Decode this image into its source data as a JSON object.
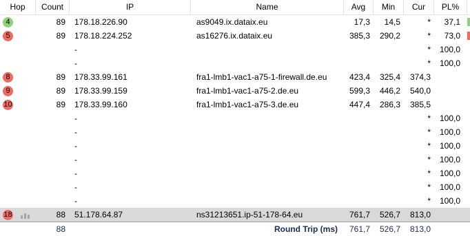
{
  "columns": [
    "Hop",
    "Count",
    "IP",
    "Name",
    "Avg",
    "Min",
    "Cur",
    "PL%"
  ],
  "colors": {
    "green": "#8fd17c",
    "red": "#f06a5f",
    "selected": "#d9d9d9",
    "accent": "#1f2a5a"
  },
  "rows": [
    {
      "hop": "4",
      "status": "green",
      "count": "89",
      "ip": "178.18.226.90",
      "name": "as9049.ix.dataix.eu",
      "avg": "17,3",
      "min": "14,5",
      "cur": "*",
      "pl": "37,1"
    },
    {
      "hop": "5",
      "status": "red",
      "count": "89",
      "ip": "178.18.224.252",
      "name": "as16276.ix.dataix.eu",
      "avg": "385,3",
      "min": "290,2",
      "cur": "*",
      "pl": "73,0"
    },
    {
      "hop": "",
      "status": "",
      "count": "",
      "ip": "-",
      "name": "",
      "avg": "",
      "min": "",
      "cur": "*",
      "pl": "100,0"
    },
    {
      "hop": "",
      "status": "",
      "count": "",
      "ip": "-",
      "name": "",
      "avg": "",
      "min": "",
      "cur": "*",
      "pl": "100,0"
    },
    {
      "hop": "8",
      "status": "red",
      "count": "89",
      "ip": "178.33.99.161",
      "name": "fra1-lmb1-vac1-a75-1-firewall.de.eu",
      "avg": "423,4",
      "min": "325,4",
      "cur": "374,3",
      "pl": ""
    },
    {
      "hop": "9",
      "status": "red",
      "count": "89",
      "ip": "178.33.99.159",
      "name": "fra1-lmb1-vac1-a75-2.de.eu",
      "avg": "599,3",
      "min": "446,2",
      "cur": "540,0",
      "pl": ""
    },
    {
      "hop": "10",
      "status": "red",
      "count": "89",
      "ip": "178.33.99.160",
      "name": "fra1-lmb1-vac1-a75-3.de.eu",
      "avg": "447,4",
      "min": "286,3",
      "cur": "385,5",
      "pl": ""
    },
    {
      "hop": "",
      "status": "",
      "count": "",
      "ip": "-",
      "name": "",
      "avg": "",
      "min": "",
      "cur": "*",
      "pl": "100,0"
    },
    {
      "hop": "",
      "status": "",
      "count": "",
      "ip": "-",
      "name": "",
      "avg": "",
      "min": "",
      "cur": "*",
      "pl": "100,0"
    },
    {
      "hop": "",
      "status": "",
      "count": "",
      "ip": "-",
      "name": "",
      "avg": "",
      "min": "",
      "cur": "*",
      "pl": "100,0"
    },
    {
      "hop": "",
      "status": "",
      "count": "",
      "ip": "-",
      "name": "",
      "avg": "",
      "min": "",
      "cur": "*",
      "pl": "100,0"
    },
    {
      "hop": "",
      "status": "",
      "count": "",
      "ip": "-",
      "name": "",
      "avg": "",
      "min": "",
      "cur": "*",
      "pl": "100,0"
    },
    {
      "hop": "",
      "status": "",
      "count": "",
      "ip": "-",
      "name": "",
      "avg": "",
      "min": "",
      "cur": "*",
      "pl": "100,0"
    },
    {
      "hop": "",
      "status": "",
      "count": "",
      "ip": "-",
      "name": "",
      "avg": "",
      "min": "",
      "cur": "*",
      "pl": "100,0"
    },
    {
      "hop": "18",
      "status": "red",
      "count": "88",
      "ip": "51.178.64.87",
      "name": "ns31213651.ip-51-178-64.eu",
      "avg": "761,7",
      "min": "526,7",
      "cur": "813,0",
      "pl": "",
      "selected": true,
      "chart_icon": "bar-chart-icon"
    }
  ],
  "total": {
    "count": "88",
    "label": "Round Trip (ms)",
    "avg": "761,7",
    "min": "526,7",
    "cur": "813,0"
  }
}
